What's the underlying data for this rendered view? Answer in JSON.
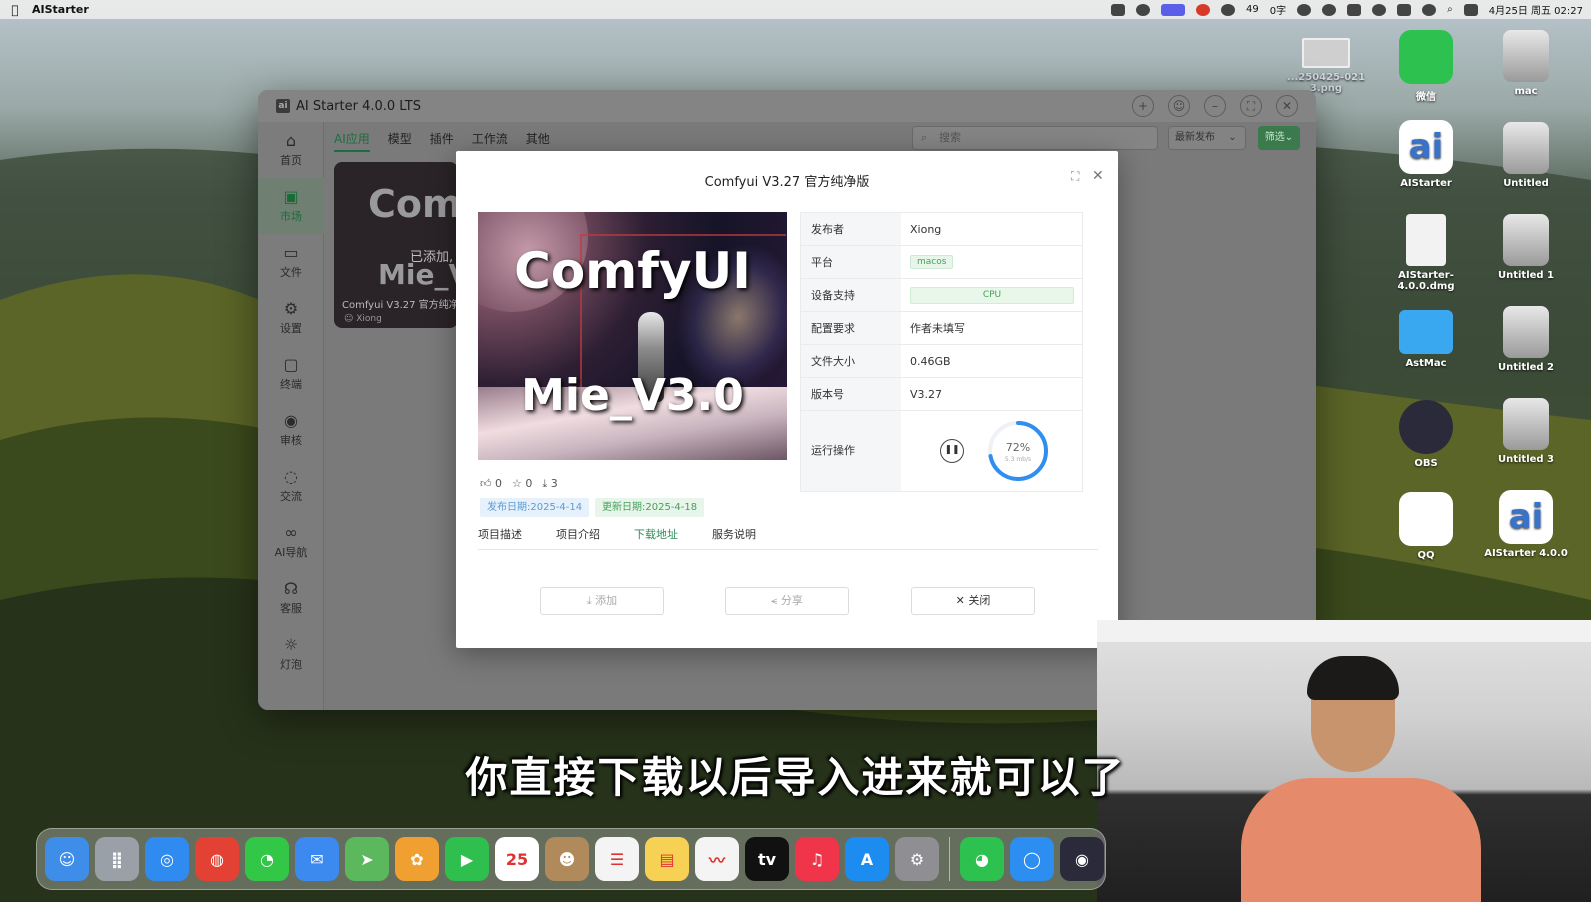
{
  "menubar": {
    "app_name": "AIStarter",
    "wechat_count": "49",
    "words": "0字",
    "datetime": "4月25日 周五 02:27"
  },
  "desktop_icons": [
    {
      "label": "...250425-021\n3.png",
      "kind": "shot"
    },
    {
      "label": "微信",
      "kind": "wechat"
    },
    {
      "label": "mac",
      "kind": "disk"
    },
    {
      "label": "AIStarter",
      "kind": "ai"
    },
    {
      "label": "Untitled",
      "kind": "disk"
    },
    {
      "label": "AIStarter-4.0.0.dmg",
      "kind": "file"
    },
    {
      "label": "Untitled 1",
      "kind": "disk"
    },
    {
      "label": "AstMac",
      "kind": "folder"
    },
    {
      "label": "Untitled 2",
      "kind": "disk"
    },
    {
      "label": "OBS",
      "kind": "obs"
    },
    {
      "label": "Untitled 3",
      "kind": "disk"
    },
    {
      "label": "QQ",
      "kind": "qq"
    },
    {
      "label": "AIStarter 4.0.0",
      "kind": "ai"
    }
  ],
  "window": {
    "title": "AI Starter 4.0.0 LTS",
    "sidebar": [
      {
        "label": "首页",
        "icon": "home-icon",
        "glyph": "⌂"
      },
      {
        "label": "市场",
        "icon": "market-icon",
        "glyph": "▣"
      },
      {
        "label": "文件",
        "icon": "file-icon",
        "glyph": "▭"
      },
      {
        "label": "设置",
        "icon": "gear-icon",
        "glyph": "⚙"
      },
      {
        "label": "终端",
        "icon": "terminal-icon",
        "glyph": "▢"
      },
      {
        "label": "审核",
        "icon": "eye-icon",
        "glyph": "◉"
      },
      {
        "label": "交流",
        "icon": "chat-icon",
        "glyph": "◌"
      },
      {
        "label": "AI导航",
        "icon": "link-icon",
        "glyph": "∞"
      },
      {
        "label": "客服",
        "icon": "headset-icon",
        "glyph": "☊"
      },
      {
        "label": "灯泡",
        "icon": "bulb-icon",
        "glyph": "☼"
      }
    ],
    "tabs": [
      "AI应用",
      "模型",
      "插件",
      "工作流",
      "其他"
    ],
    "search_placeholder": "搜索",
    "sort_value": "最新发布",
    "filter_label": "筛选",
    "card": {
      "big_text": "Com",
      "added_text": "已添加,",
      "mie_text": "Mie_V",
      "name": "Comfyui V3.27 官方纯净",
      "author": "Xiong"
    }
  },
  "modal": {
    "title": "Comfyui V3.27 官方纯净版",
    "hero_title": "ComfyUI",
    "hero_subtitle": "Mie_V3.0",
    "likes": "0",
    "stars": "0",
    "downloads": "3",
    "publish_date": "发布日期:2025-4-14",
    "update_date": "更新日期:2025-4-18",
    "subtabs": [
      "项目描述",
      "项目介绍",
      "下载地址",
      "服务说明"
    ],
    "active_subtab": 2,
    "info": {
      "publisher_label": "发布者",
      "publisher": "Xiong",
      "platform_label": "平台",
      "platform": "macos",
      "device_label": "设备支持",
      "device": "CPU",
      "config_label": "配置要求",
      "config": "作者未填写",
      "size_label": "文件大小",
      "size": "0.46GB",
      "version_label": "版本号",
      "version": "V3.27",
      "run_label": "运行操作",
      "progress_text": "72%",
      "progress_value": 0.72,
      "speed": "5.3 mb/s"
    },
    "buttons": {
      "add": "⤓ 添加",
      "share": "⪪ 分享",
      "close": "✕ 关闭"
    }
  },
  "subtitle": "你直接下载以后导入进来就可以了",
  "dock": [
    {
      "name": "finder",
      "color": "#3e8de8",
      "glyph": "☺"
    },
    {
      "name": "launchpad",
      "color": "#9aa0a8",
      "glyph": "⣿"
    },
    {
      "name": "safari",
      "color": "#2f8bf0",
      "glyph": "◎"
    },
    {
      "name": "chrome",
      "color": "#e44135",
      "glyph": "◍"
    },
    {
      "name": "messages",
      "color": "#33c748",
      "glyph": "◔"
    },
    {
      "name": "mail",
      "color": "#3c8af0",
      "glyph": "✉"
    },
    {
      "name": "maps",
      "color": "#5cb85c",
      "glyph": "➤"
    },
    {
      "name": "photos",
      "color": "#f0a030",
      "glyph": "✿"
    },
    {
      "name": "facetime",
      "color": "#2fbf4f",
      "glyph": "▶"
    },
    {
      "name": "calendar",
      "color": "#ffffff",
      "glyph": "25"
    },
    {
      "name": "contacts",
      "color": "#b08a5a",
      "glyph": "☻"
    },
    {
      "name": "reminders",
      "color": "#f4f4f4",
      "glyph": "☰"
    },
    {
      "name": "notes",
      "color": "#f7d154",
      "glyph": "▤"
    },
    {
      "name": "freeform",
      "color": "#f4f4f4",
      "glyph": "〰"
    },
    {
      "name": "tv",
      "color": "#111111",
      "glyph": "tv"
    },
    {
      "name": "music",
      "color": "#f0344a",
      "glyph": "♫"
    },
    {
      "name": "appstore",
      "color": "#1c8cf0",
      "glyph": "A"
    },
    {
      "name": "settings",
      "color": "#8e8e93",
      "glyph": "⚙"
    },
    {
      "name": "wechat",
      "color": "#2dc24f",
      "glyph": "◕"
    },
    {
      "name": "qq-browser",
      "color": "#2b8ef0",
      "glyph": "◯"
    },
    {
      "name": "obs",
      "color": "#2a2a3a",
      "glyph": "◉"
    }
  ],
  "calendar_month": "4月"
}
